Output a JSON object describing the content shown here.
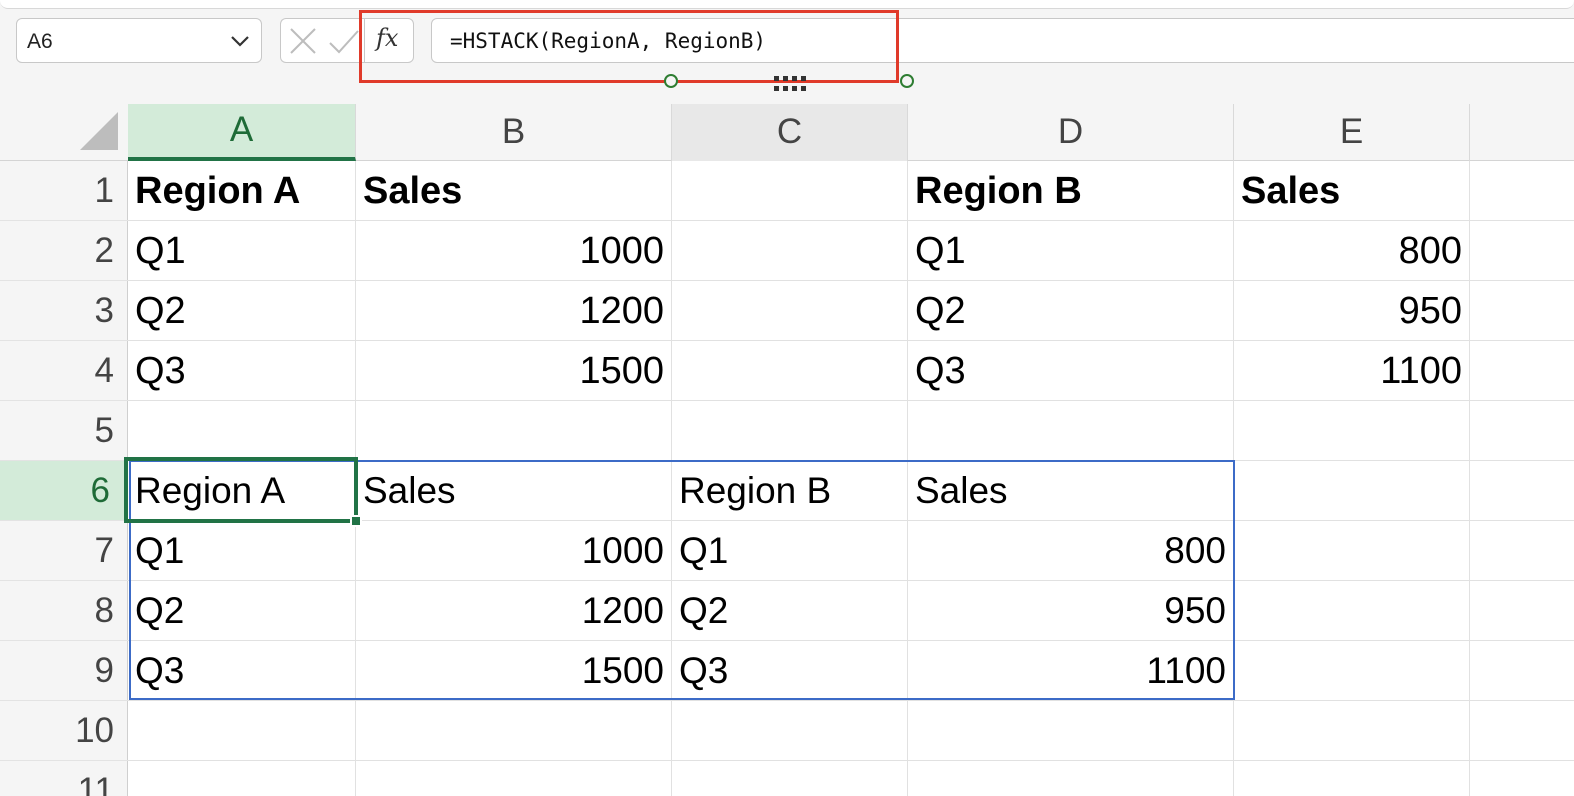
{
  "formula_bar": {
    "name_box": "A6",
    "fx_label": "fx",
    "formula": "=HSTACK(RegionA, RegionB)"
  },
  "columns": [
    "A",
    "B",
    "C",
    "D",
    "E"
  ],
  "rows": [
    "1",
    "2",
    "3",
    "4",
    "5",
    "6",
    "7",
    "8",
    "9",
    "10",
    "11"
  ],
  "source_table_a": {
    "header": [
      "Region A",
      "Sales"
    ],
    "rows": [
      [
        "Q1",
        "1000"
      ],
      [
        "Q2",
        "1200"
      ],
      [
        "Q3",
        "1500"
      ]
    ]
  },
  "source_table_b": {
    "header": [
      "Region B",
      "Sales"
    ],
    "rows": [
      [
        "Q1",
        "800"
      ],
      [
        "Q2",
        "950"
      ],
      [
        "Q3",
        "1100"
      ]
    ]
  },
  "spill_result": {
    "header": [
      "Region A",
      "Sales",
      "Region B",
      "Sales"
    ],
    "rows": [
      [
        "Q1",
        "1000",
        "Q1",
        "800"
      ],
      [
        "Q2",
        "1200",
        "Q2",
        "950"
      ],
      [
        "Q3",
        "1500",
        "Q3",
        "1100"
      ]
    ]
  },
  "colors": {
    "accent_green": "#217346",
    "spill_blue": "#3c6bc7",
    "highlight_red": "#e03a2a"
  }
}
